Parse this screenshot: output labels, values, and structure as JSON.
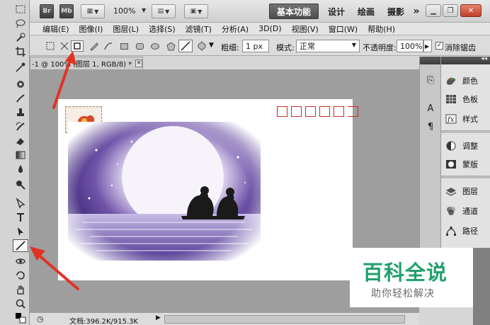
{
  "appbar": {
    "br_label": "Br",
    "mb_label": "Mb",
    "zoom": "100%",
    "workspaces": [
      "基本功能",
      "设计",
      "绘画",
      "摄影"
    ],
    "more": "»"
  },
  "menu": [
    "编辑(E)",
    "图像(I)",
    "图层(L)",
    "选择(S)",
    "滤镜(T)",
    "分析(A)",
    "3D(D)",
    "视图(V)",
    "窗口(W)",
    "帮助(H)"
  ],
  "options": {
    "weight_label": "粗细:",
    "weight_value": "1 px",
    "mode_label": "模式:",
    "mode_value": "正常",
    "opacity_label": "不透明度:",
    "opacity_value": "100%",
    "antialias_label": "消除锯齿",
    "antialias_checked": true
  },
  "document": {
    "tab_title": "-1 @ 100% (图层 1, RGB/8) *",
    "close": "×"
  },
  "status": {
    "doc_size": "文档:396.2K/915.3K"
  },
  "panels": {
    "items": [
      {
        "label": "颜色",
        "icon": "color-icon"
      },
      {
        "label": "色板",
        "icon": "swatches-icon"
      },
      {
        "label": "样式",
        "icon": "styles-icon"
      },
      {
        "label": "调整",
        "icon": "adjustments-icon"
      },
      {
        "label": "蒙版",
        "icon": "masks-icon"
      },
      {
        "label": "图层",
        "icon": "layers-icon"
      },
      {
        "label": "通道",
        "icon": "channels-icon"
      },
      {
        "label": "路径",
        "icon": "paths-icon"
      }
    ],
    "collapse_glyph": "◂◂"
  },
  "watermark": {
    "title": "百科全说",
    "subtitle": "助你轻松解决"
  },
  "colors": {
    "accent_green": "#23a06e",
    "arrow_red": "#e03325",
    "zip_red": "#cc2a22"
  }
}
